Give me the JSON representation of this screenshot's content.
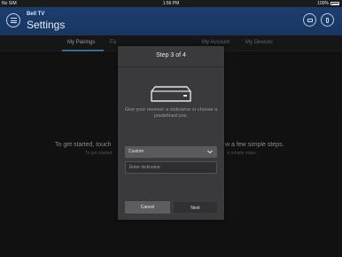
{
  "status_bar": {
    "carrier": "No SIM",
    "time": "1:56 PM",
    "battery": "100%"
  },
  "header": {
    "brand": "Bell TV",
    "title": "Settings"
  },
  "tabs": [
    {
      "label": "My Pairings"
    },
    {
      "label": "Fa"
    },
    {
      "label": "My Account"
    },
    {
      "label": "My Devices"
    }
  ],
  "background": {
    "line1_left": "To get started, touch",
    "line1_right": "w a few simple steps.",
    "line2_left": "To get started,",
    "line2_right": "w simple steps."
  },
  "modal": {
    "title": "Step 3 of 4",
    "description": "Give your receiver a nickname or choose a predefined one.",
    "select_value": "Custom",
    "input_placeholder": "Enter nickname",
    "cancel_label": "Cancel",
    "next_label": "Next"
  },
  "colors": {
    "header_blue": "#1c3d6d",
    "tab_accent": "#5aa7e0",
    "modal_bg": "#3a3a3c"
  }
}
